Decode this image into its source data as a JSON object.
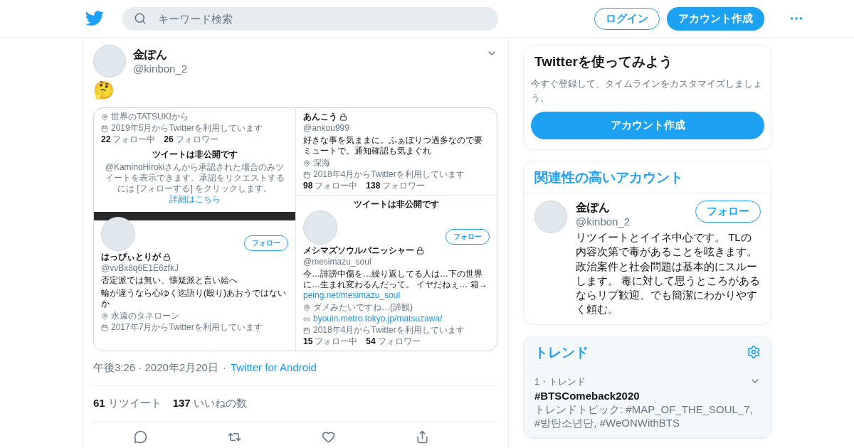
{
  "header": {
    "search": {
      "placeholder": "キーワード検索"
    },
    "login": "ログイン",
    "signup": "アカウント作成"
  },
  "tweet": {
    "name": "金ぽん",
    "handle": "@kinbon_2",
    "text": "🤔",
    "screenshot": {
      "columns": [
        [
          {
            "blocks": [
              {
                "kind": "location",
                "text": "世界のTATSUKIから"
              },
              {
                "kind": "joined",
                "text": "2019年5月からTwitterを利用しています"
              },
              {
                "kind": "stats",
                "following": "22",
                "following_label": "フォロー中",
                "followers": "26",
                "followers_label": "フォロワー"
              },
              {
                "kind": "notice",
                "title": "ツイートは非公開です",
                "body": "@KaminoHirokiさんから承認された場合のみツイートを表示できます。承認をリクエストするには [フォローする] をクリックします。",
                "link": "詳細はこちら"
              }
            ]
          },
          {
            "blocks": [
              {
                "kind": "header",
                "banner": true,
                "follow": "フォロー"
              },
              {
                "kind": "name",
                "text": "はっぴぃとりが",
                "locked": true
              },
              {
                "kind": "handle",
                "text": "@vvBx8q6E1E6zfkJ"
              },
              {
                "kind": "bio",
                "text": "否定派では無い、懐疑派と言い給へ"
              },
              {
                "kind": "bio",
                "text": "輪が違うなら心ゆく迄語り(殴り)あおうではないか"
              },
              {
                "kind": "location",
                "text": "永遠のタネローン"
              },
              {
                "kind": "joined",
                "text": "2017年7月からTwitterを利用しています"
              }
            ]
          }
        ],
        [
          {
            "blocks": [
              {
                "kind": "name",
                "text": "あんこう",
                "locked": true
              },
              {
                "kind": "handle",
                "text": "@ankou999"
              },
              {
                "kind": "bio",
                "text": "好きな事を気ままに。ふぁぼりつ過多なので要ミュートで。通知確認も気まぐれ"
              },
              {
                "kind": "location",
                "text": "深海"
              },
              {
                "kind": "joined",
                "text": "2018年4月からTwitterを利用しています"
              },
              {
                "kind": "stats",
                "following": "98",
                "following_label": "フォロー中",
                "followers": "138",
                "followers_label": "フォロワー"
              }
            ]
          },
          {
            "blocks": [
              {
                "kind": "heading",
                "text": "ツイートは非公開です"
              },
              {
                "kind": "header",
                "banner": false,
                "follow": "フォロー"
              },
              {
                "kind": "name",
                "text": "メシマズソウルパニッシャー",
                "locked": true
              },
              {
                "kind": "handle",
                "text": "@mesimazu_soul"
              },
              {
                "kind": "bio",
                "text": "今…誹謗中傷を…繰り返してる人は…下の世界に…生まれ変わるんだって。 イヤだねぇ… 箱→",
                "link": "peing.net/mesimazu_soul"
              },
              {
                "kind": "location",
                "text": "ダメみたいですね…(諦観)"
              },
              {
                "kind": "url",
                "text": "byouin.metro.tokyo.jp/matsuzawa/"
              },
              {
                "kind": "joined",
                "text": "2018年4月からTwitterを利用しています"
              },
              {
                "kind": "stats",
                "following": "15",
                "following_label": "フォロー中",
                "followers": "54",
                "followers_label": "フォロワー"
              }
            ]
          }
        ]
      ]
    },
    "time": "午後3:26 · 2020年2月20日",
    "separator": "·",
    "client": "Twitter for Android",
    "stats": [
      {
        "count": "61",
        "label": "リツイート"
      },
      {
        "count": "137",
        "label": "いいねの数"
      }
    ]
  },
  "sidebar": {
    "signup_card": {
      "title": "Twitterを使ってみよう",
      "text": "今すぐ登録して、タイムラインをカスタマイズしましょう。",
      "button": "アカウント作成"
    },
    "related": {
      "title": "関連性の高いアカウント",
      "accounts": [
        {
          "name": "金ぽん",
          "handle": "@kinbon_2",
          "follow": "フォロー",
          "bio": "リツイートとイイネ中心です。 TLの内容次第で毒があることを呟きます。政治案件と社会問題は基本的にスルーします。 毒に対して思うところがあるならリプ歓迎、でも簡潔にわかりやすく頼む。"
        }
      ]
    },
    "trends": {
      "title": "トレンド",
      "items": [
        {
          "meta": "1・トレンド",
          "name": "#BTSComeback2020",
          "description": "トレンドトピック: #MAP_OF_THE_SOUL_7, #방탄소년단, #WeONWithBTS"
        }
      ]
    }
  }
}
